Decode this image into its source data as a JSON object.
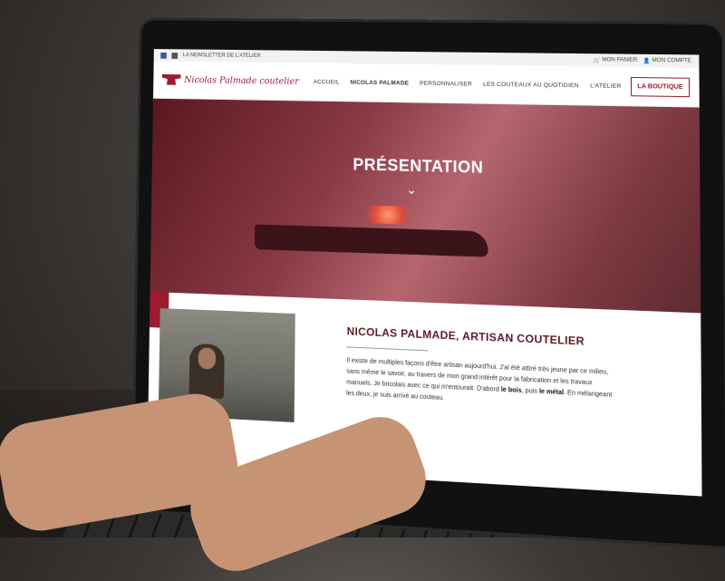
{
  "topbar": {
    "newsletter": "LA NEWSLETTER DE L'ATELIER",
    "cart": "MON PANIER",
    "account": "MON COMPTE"
  },
  "nav": {
    "logo": "Nicolas Palmade coutelier",
    "items": [
      "ACCUEIL",
      "NICOLAS PALMADE",
      "PERSONNALISER",
      "LES COUTEAUX AU QUOTIDIEN",
      "L'ATELIER"
    ],
    "shop": "LA BOUTIQUE"
  },
  "hero": {
    "title": "PRÉSENTATION"
  },
  "section": {
    "title": "NICOLAS PALMADE, ARTISAN COUTELIER",
    "p1": "Il existe de multiples façons d'être artisan aujourd'hui. J'ai été attiré très jeune par ce milieu, sans même le savoir, au travers de mon grand intérêt pour la fabrication et les travaux manuels. Je bricolais avec ce qui m'entourait. D'abord",
    "bold1": "le bois",
    "p2": ", puis",
    "bold2": "le métal",
    "p3": ". En mélangeant les deux, je suis arrivé au couteau."
  },
  "colors": {
    "accent": "#9b1b30"
  }
}
